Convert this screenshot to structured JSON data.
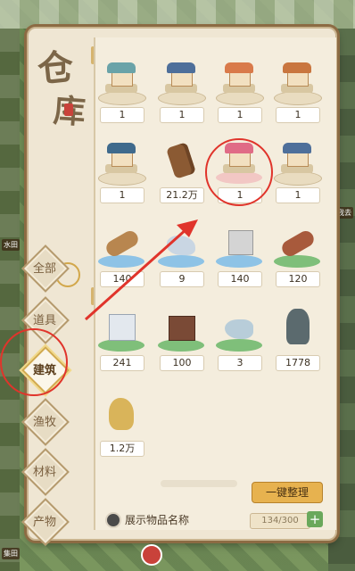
{
  "title": {
    "char1": "仓",
    "char2": "库"
  },
  "tabs": [
    {
      "label": "全部"
    },
    {
      "label": "道具"
    },
    {
      "label": "建筑"
    },
    {
      "label": "渔牧"
    },
    {
      "label": "材料"
    },
    {
      "label": "产物"
    }
  ],
  "active_tab": "建筑",
  "items": [
    {
      "qty": "1",
      "icon": "pavilion-building-icon",
      "pedestal": "paper"
    },
    {
      "qty": "1",
      "icon": "house-building-icon",
      "pedestal": "paper"
    },
    {
      "qty": "1",
      "icon": "garden-building-icon",
      "pedestal": "paper"
    },
    {
      "qty": "1",
      "icon": "tower-building-icon",
      "pedestal": "paper"
    },
    {
      "qty": "1",
      "icon": "temple-building-icon",
      "pedestal": "paper"
    },
    {
      "qty": "21.2万",
      "icon": "tree-stump-icon",
      "pedestal": "none"
    },
    {
      "qty": "1",
      "icon": "flower-pavilion-icon",
      "pedestal": "red"
    },
    {
      "qty": "1",
      "icon": "small-pavilion-icon",
      "pedestal": "paper"
    },
    {
      "qty": "140",
      "icon": "wood-log-icon",
      "pedestal": "blue"
    },
    {
      "qty": "9",
      "icon": "ore-stone-icon",
      "pedestal": "blue"
    },
    {
      "qty": "140",
      "icon": "stone-block-icon",
      "pedestal": "blue"
    },
    {
      "qty": "120",
      "icon": "red-log-icon",
      "pedestal": "green"
    },
    {
      "qty": "241",
      "icon": "marble-block-icon",
      "pedestal": "green"
    },
    {
      "qty": "100",
      "icon": "clay-block-icon",
      "pedestal": "green"
    },
    {
      "qty": "3",
      "icon": "jade-stone-icon",
      "pedestal": "green"
    },
    {
      "qty": "1778",
      "icon": "dark-rock-icon",
      "pedestal": "none"
    },
    {
      "qty": "1.2万",
      "icon": "gold-ore-icon",
      "pedestal": "none"
    }
  ],
  "bottom": {
    "arrange_button": "一键整理",
    "show_names_label": "展示物品名称",
    "capacity": "134/300",
    "plus": "+"
  },
  "world_tags": {
    "left_1": "水田",
    "right_1": "我去",
    "left_2": "集田"
  },
  "colors": {
    "highlight": "#e0342b",
    "accent": "#e7b24f"
  }
}
